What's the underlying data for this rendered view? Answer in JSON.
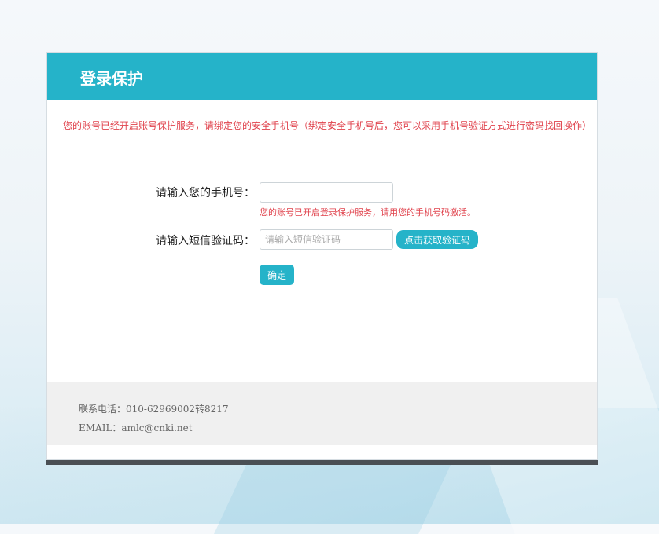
{
  "header": {
    "title": "登录保护"
  },
  "notice": "您的账号已经开启账号保护服务，请绑定您的安全手机号（绑定安全手机号后，您可以采用手机号验证方式进行密码找回操作）",
  "form": {
    "phone_label": "请输入您的手机号：",
    "phone_value": "",
    "phone_hint": "您的账号已开启登录保护服务，请用您的手机号码激活。",
    "code_label": "请输入短信验证码：",
    "code_placeholder": "请输入短信验证码",
    "sms_button_label": "点击获取验证码",
    "confirm_label": "确定"
  },
  "footer": {
    "phone": "联系电话：010-62969002转8217",
    "email": "EMAIL：amlc@cnki.net"
  },
  "colors": {
    "accent": "#25b3c9",
    "warning": "#e0424c",
    "footer_bg": "#f0f0f0"
  }
}
